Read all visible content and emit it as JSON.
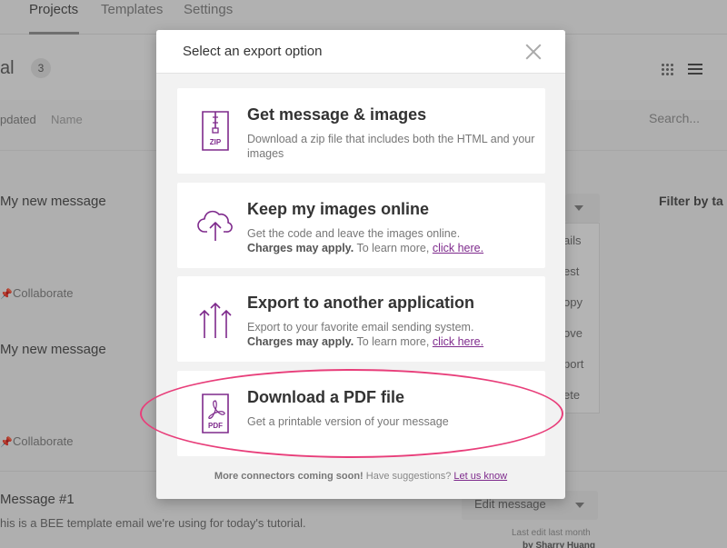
{
  "background": {
    "tabs": [
      "Projects",
      "Templates",
      "Settings"
    ],
    "title_fragment": "al",
    "count": "3",
    "sort_updated": "pdated",
    "sort_name": "Name",
    "search_placeholder": "Search...",
    "cards": [
      {
        "title": "My new message",
        "collaborate": "Collaborate"
      },
      {
        "title": "My new message",
        "collaborate": "Collaborate"
      }
    ],
    "filter_label": "Filter by ta",
    "menu_fragments": [
      "ails",
      "est",
      "opy",
      "ove",
      "port",
      "ete"
    ],
    "message": {
      "title": "Message #1",
      "description": "his is a BEE template email we're using for today's tutorial.",
      "edit_label": "Edit message",
      "last_edit": "Last edit last month",
      "by": "by Sharry Huang"
    }
  },
  "modal": {
    "title": "Select an export option",
    "options": [
      {
        "title": "Get message & images",
        "desc": "Download a zip file that includes both the HTML and your images",
        "icon_label": "ZIP"
      },
      {
        "title": "Keep my images online",
        "desc": "Get the code and leave the images online.",
        "charges": "Charges may apply.",
        "learn": "To learn more,",
        "link": "click here."
      },
      {
        "title": "Export to another application",
        "desc": "Export to your favorite email sending system.",
        "charges": "Charges may apply.",
        "learn": "To learn more,",
        "link": "click here."
      },
      {
        "title": "Download a PDF file",
        "desc": "Get a printable version of your message",
        "icon_label": "PDF"
      }
    ],
    "footer": {
      "coming": "More connectors coming soon!",
      "suggest": "Have suggestions?",
      "link": "Let us know"
    }
  },
  "colors": {
    "accent_purple": "#7e2a8c",
    "highlight_pink": "#e83e7a"
  },
  "icons": [
    "zip-file-icon",
    "cloud-upload-icon",
    "export-arrows-icon",
    "pdf-file-icon",
    "close-icon"
  ]
}
